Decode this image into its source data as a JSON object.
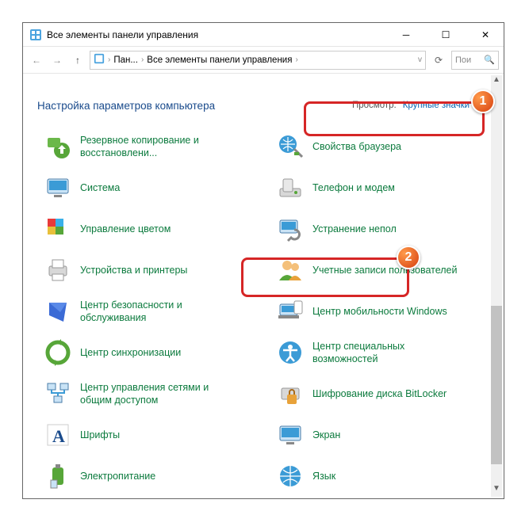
{
  "window": {
    "title": "Все элементы панели управления"
  },
  "breadcrumb": {
    "item1": "Пан...",
    "item2": "Все элементы панели управления"
  },
  "search": {
    "placeholder": "Пои"
  },
  "header": {
    "title": "Настройка параметров компьютера"
  },
  "view": {
    "label": "Просмотр:",
    "value": "Крупные значки"
  },
  "items": [
    {
      "label": "Резервное копирование и восстановлени...",
      "icon": "backup-icon"
    },
    {
      "label": "Свойства браузера",
      "icon": "internet-options-icon"
    },
    {
      "label": "Система",
      "icon": "system-icon"
    },
    {
      "label": "Телефон и модем",
      "icon": "phone-modem-icon"
    },
    {
      "label": "Управление цветом",
      "icon": "color-management-icon"
    },
    {
      "label": "Устранение непол",
      "icon": "troubleshoot-icon"
    },
    {
      "label": "Устройства и принтеры",
      "icon": "devices-printers-icon"
    },
    {
      "label": "Учетные записи пользователей",
      "icon": "user-accounts-icon"
    },
    {
      "label": "Центр безопасности и обслуживания",
      "icon": "security-maintenance-icon"
    },
    {
      "label": "Центр мобильности Windows",
      "icon": "mobility-center-icon"
    },
    {
      "label": "Центр синхронизации",
      "icon": "sync-center-icon"
    },
    {
      "label": "Центр специальных возможностей",
      "icon": "accessibility-center-icon"
    },
    {
      "label": "Центр управления сетями и общим доступом",
      "icon": "network-sharing-icon"
    },
    {
      "label": "Шифрование диска BitLocker",
      "icon": "bitlocker-icon"
    },
    {
      "label": "Шрифты",
      "icon": "fonts-icon"
    },
    {
      "label": "Экран",
      "icon": "display-icon"
    },
    {
      "label": "Электропитание",
      "icon": "power-options-icon"
    },
    {
      "label": "Язык",
      "icon": "language-icon"
    }
  ],
  "callouts": {
    "badge1": "1",
    "badge2": "2"
  }
}
